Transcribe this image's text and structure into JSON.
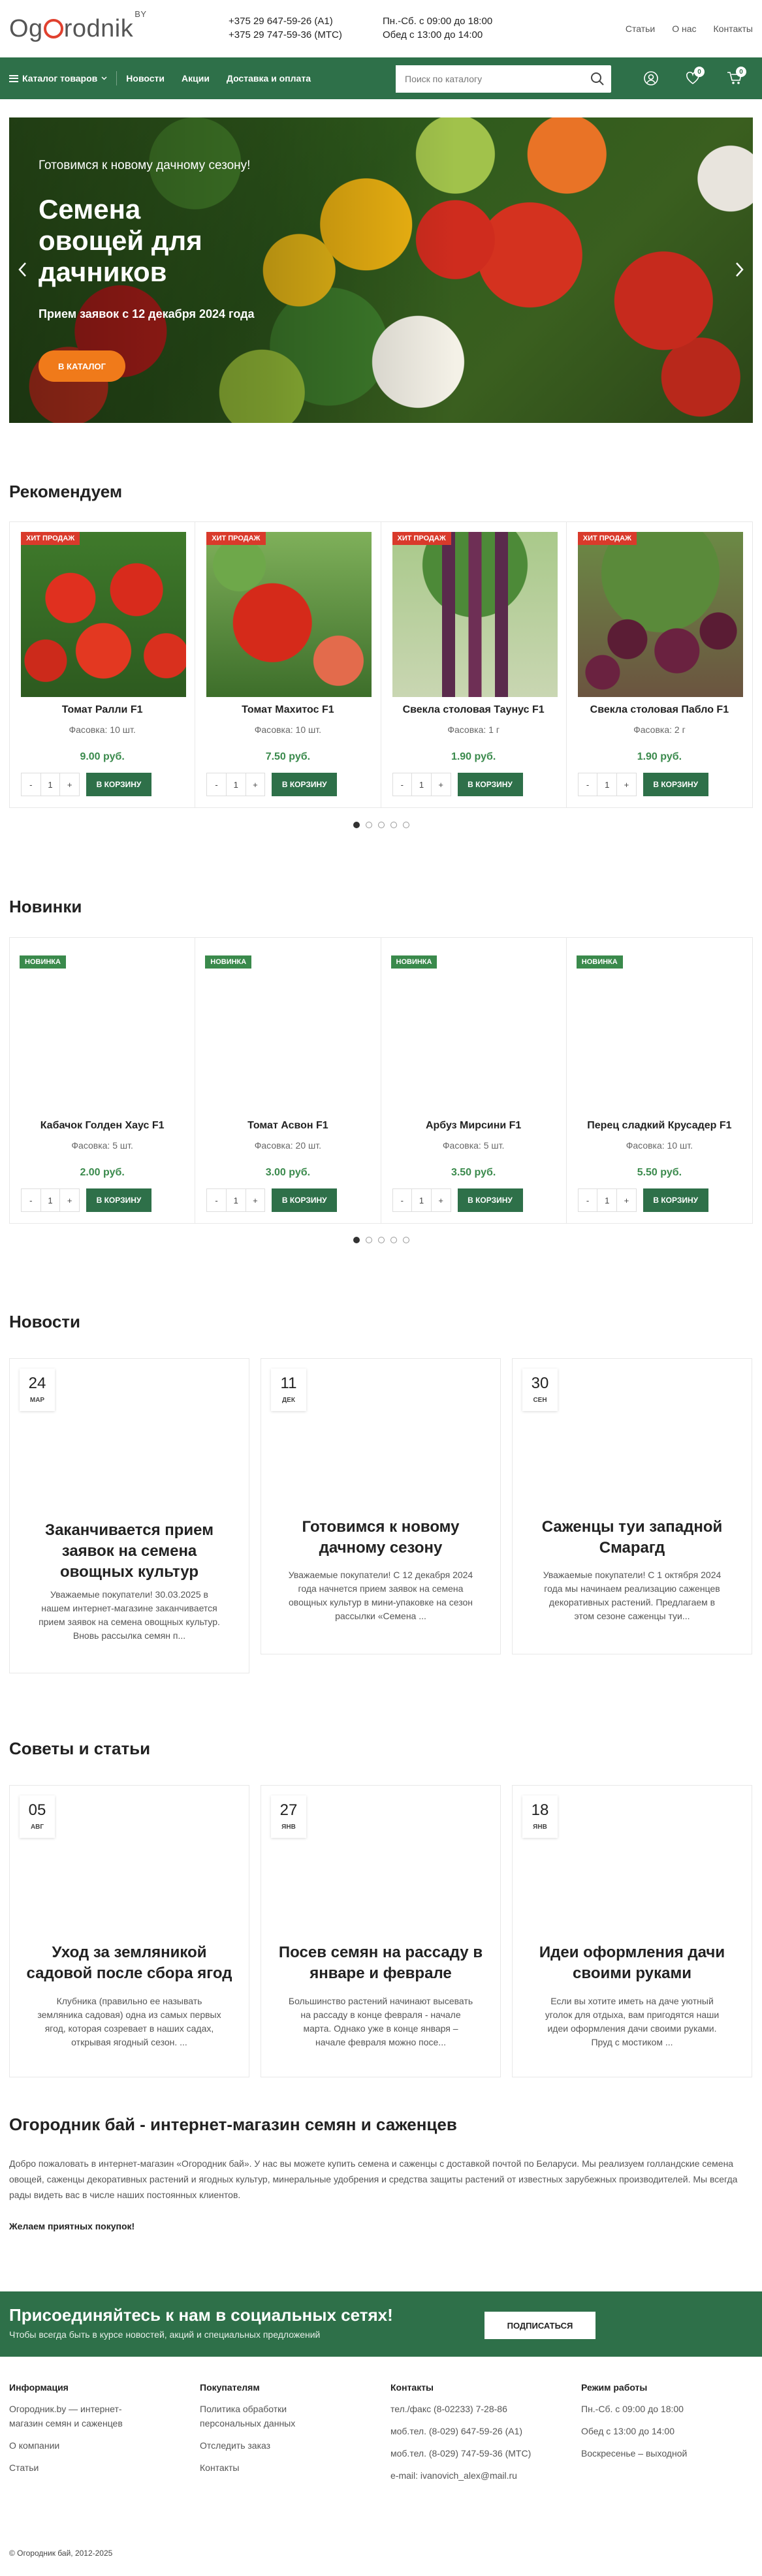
{
  "header": {
    "logo_text": "Ogorodnik",
    "logo_sup": "BY",
    "phone1": "+375 29 647-59-26 (A1)",
    "phone2": "+375 29 747-59-36 (МТС)",
    "hours1": "Пн.-Сб. с 09:00 до 18:00",
    "hours2": "Обед с 13:00 до 14:00",
    "links": [
      "Статьи",
      "О нас",
      "Контакты"
    ]
  },
  "nav": {
    "catalog": "Каталог товаров",
    "links": [
      "Новости",
      "Акции",
      "Доставка и оплата"
    ],
    "search_placeholder": "Поиск по каталогу",
    "wishlist_count": "0",
    "cart_count": "0",
    "color": "#2e7049"
  },
  "hero": {
    "pre": "Готовимся к новому дачному сезону!",
    "title": "Семена овощей для дачников",
    "subtitle": "Прием заявок с 12 декабря 2024 года",
    "button": "В КАТАЛОГ"
  },
  "recommended": {
    "title": "Рекомендуем",
    "items": [
      {
        "tag": "ХИТ ПРОДАЖ",
        "name": "Томат Ралли F1",
        "pack": "Фасовка: 10 шт.",
        "price": "9.00 руб.",
        "qty": "1",
        "buy": "В КОРЗИНУ",
        "img": "tomatoes-photo"
      },
      {
        "tag": "ХИТ ПРОДАЖ",
        "name": "Томат Махитос F1",
        "pack": "Фасовка: 10 шт.",
        "price": "7.50 руб.",
        "qty": "1",
        "buy": "В КОРЗИНУ",
        "img": "tomato-vine-photo"
      },
      {
        "tag": "ХИТ ПРОДАЖ",
        "name": "Свекла столовая Таунус F1",
        "pack": "Фасовка: 1 г",
        "price": "1.90 руб.",
        "qty": "1",
        "buy": "В КОРЗИНУ",
        "img": "beets-photo"
      },
      {
        "tag": "ХИТ ПРОДАЖ",
        "name": "Свекла столовая Пабло F1",
        "pack": "Фасовка: 2 г",
        "price": "1.90 руб.",
        "qty": "1",
        "buy": "В КОРЗИНУ",
        "img": "beets-field-photo"
      }
    ]
  },
  "new_items": {
    "title": "Новинки",
    "items": [
      {
        "tag": "НОВИНКА",
        "name": "Кабачок Голден Хаус F1",
        "pack": "Фасовка: 5 шт.",
        "price": "2.00 руб.",
        "qty": "1",
        "buy": "В КОРЗИНУ"
      },
      {
        "tag": "НОВИНКА",
        "name": "Томат Асвон F1",
        "pack": "Фасовка: 20 шт.",
        "price": "3.00 руб.",
        "qty": "1",
        "buy": "В КОРЗИНУ"
      },
      {
        "tag": "НОВИНКА",
        "name": "Арбуз Мирсини F1",
        "pack": "Фасовка: 5 шт.",
        "price": "3.50 руб.",
        "qty": "1",
        "buy": "В КОРЗИНУ"
      },
      {
        "tag": "НОВИНКА",
        "name": "Перец сладкий Крусадер F1",
        "pack": "Фасовка: 10 шт.",
        "price": "5.50 руб.",
        "qty": "1",
        "buy": "В КОРЗИНУ"
      }
    ]
  },
  "news": {
    "title": "Новости",
    "items": [
      {
        "day": "24",
        "month": "МАР",
        "title": "Заканчивается прием заявок на семена овощных культур",
        "text": "Уважаемые покупатели! 30.03.2025 в нашем интернет-магазине заканчивается прием заявок на семена овощных культур. Вновь рассылка семян п..."
      },
      {
        "day": "11",
        "month": "ДЕК",
        "title": "Готовимся к новому дачному сезону",
        "text": "Уважаемые покупатели! С 12 декабря 2024 года начнется прием заявок на семена овощных культур в мини-упаковке на сезон рассылки «Семена ..."
      },
      {
        "day": "30",
        "month": "СЕН",
        "title": "Саженцы туи западной Смарагд",
        "text": "Уважаемые покупатели! С 1 октября 2024 года мы начинаем реализацию саженцев декоративных растений. Предлагаем в этом сезоне саженцы туи..."
      }
    ]
  },
  "articles": {
    "title": "Советы и статьи",
    "items": [
      {
        "day": "05",
        "month": "АВГ",
        "title": "Уход за земляникой садовой после сбора ягод",
        "text": "Клубника (правильно ее называть земляника садовая) одна из самых первых ягод, которая созревает в наших садах, открывая ягодный сезон. ..."
      },
      {
        "day": "27",
        "month": "ЯНВ",
        "title": "Посев семян на рассаду в январе и феврале",
        "text": "Большинство растений начинают высевать на рассаду в конце февраля - начале марта. Однако уже в конце января – начале февраля можно посе..."
      },
      {
        "day": "18",
        "month": "ЯНВ",
        "title": "Идеи оформления дачи своими руками",
        "text": "Если вы хотите иметь на даче уютный уголок для отдыха, вам пригодятся наши идеи оформления дачи своими руками. Пруд с мостиком ..."
      }
    ]
  },
  "about": {
    "title": "Огородник бай - интернет-магазин семян и саженцев",
    "text": "Добро пожаловать в интернет-магазин «Огородник бай». У нас вы можете купить семена и саженцы с доставкой почтой по Беларуси. Мы реализуем голландские семена овощей, саженцы декоративных растений и ягодных культур, минеральные удобрения и средства защиты растений от известных зарубежных производителей. Мы всегда рады видеть вас в числе наших постоянных клиентов.",
    "bold": "Желаем приятных покупок!"
  },
  "social": {
    "title": "Присоединяйтесь к нам в социальных сетях!",
    "text": "Чтобы всегда быть в курсе новостей, акций и специальных предложений",
    "button": "ПОДПИСАТЬСЯ"
  },
  "footer": {
    "col1": {
      "title": "Информация",
      "items": [
        "Огородник.by — интернет-магазин семян и саженцев",
        "О компании",
        "Статьи"
      ]
    },
    "col2": {
      "title": "Покупателям",
      "items": [
        "Политика обработки персональных данных",
        "Отследить заказ",
        "Контакты"
      ]
    },
    "col3": {
      "title": "Контакты",
      "items": [
        "тел./факс (8-02233) 7-28-86",
        "моб.тел. (8-029) 647-59-26 (А1)",
        "моб.тел. (8-029) 747-59-36 (МТС)",
        "e-mail: ivanovich_alex@mail.ru"
      ]
    },
    "col4": {
      "title": "Режим работы",
      "items": [
        "Пн.-Сб. с 09:00 до 18:00",
        "Обед с 13:00 до 14:00",
        "Воскресенье – выходной"
      ]
    },
    "copyright": "© Огородник бай, 2012-2025"
  }
}
